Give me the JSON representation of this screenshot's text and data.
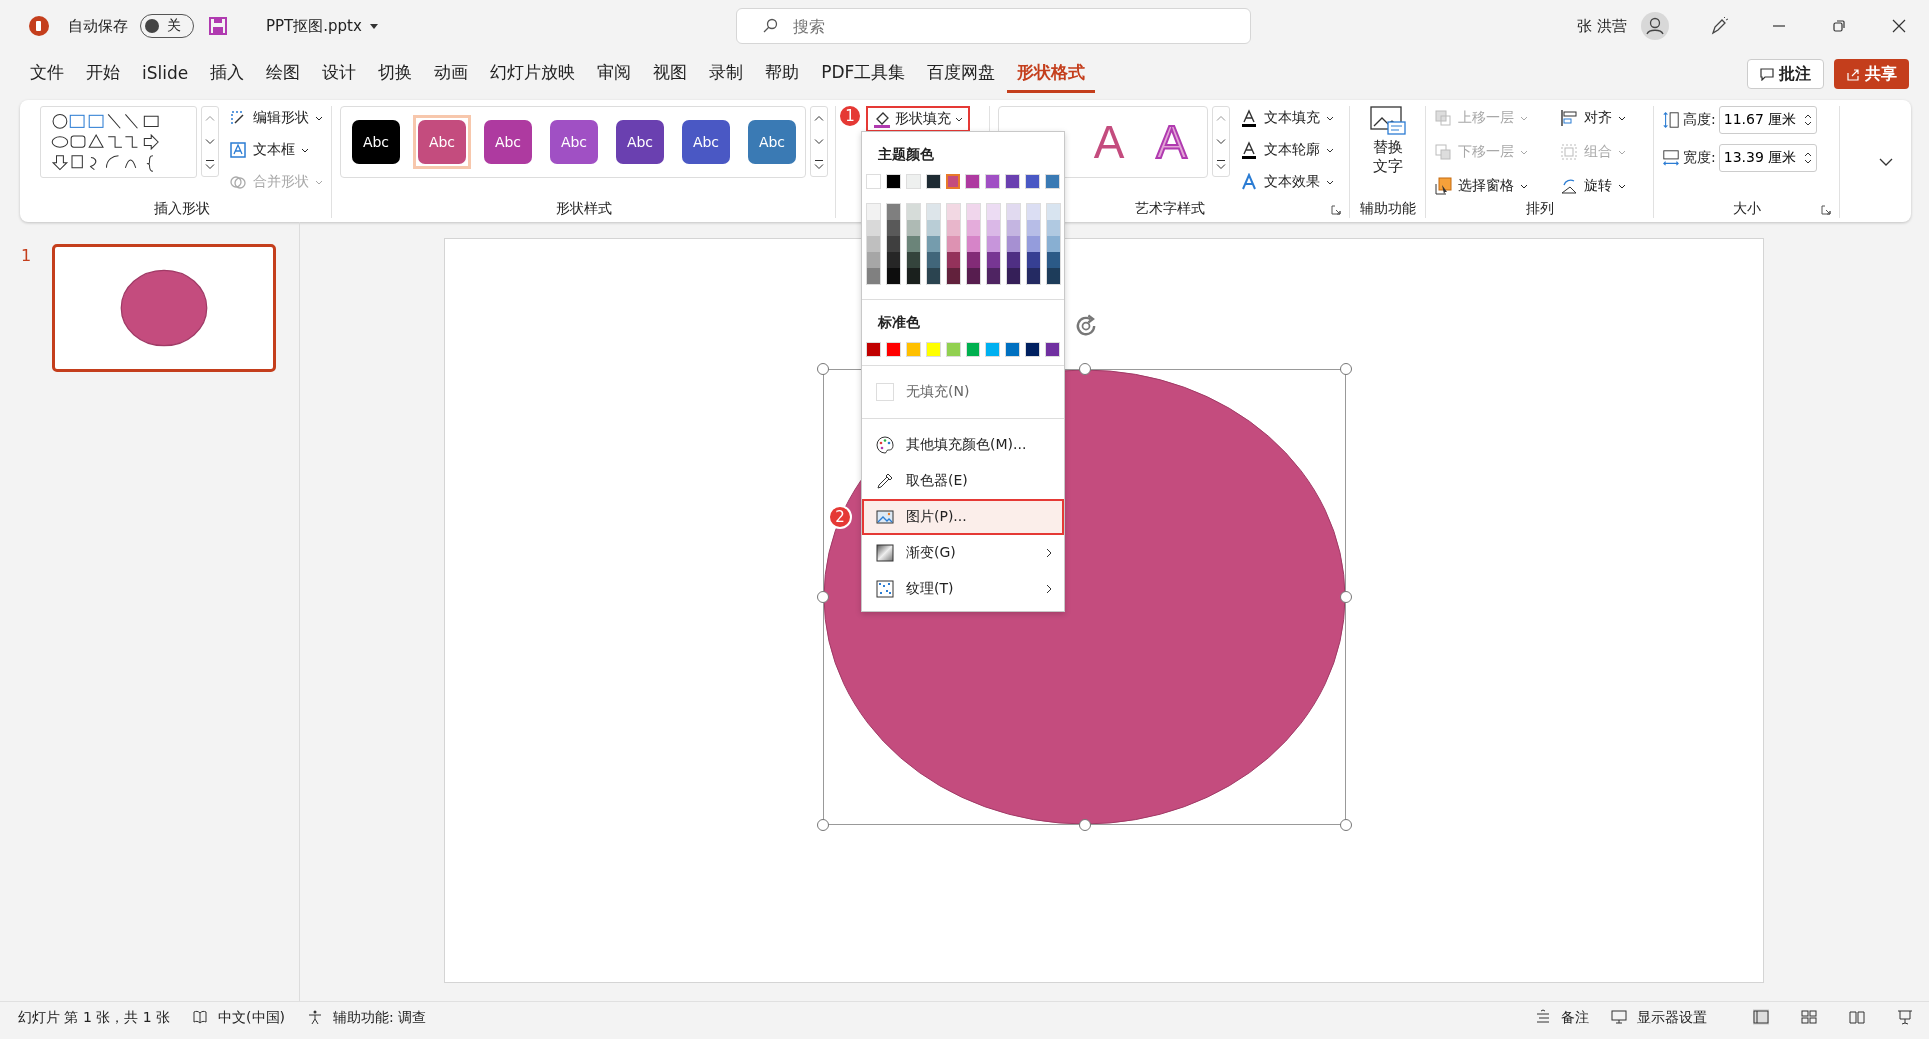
{
  "title_bar": {
    "autosave_label": "自动保存",
    "autosave": {
      "on": false,
      "label": "关"
    },
    "file_name": "PPT抠图.pptx",
    "search_placeholder": "搜索",
    "user_name": "张 洪营"
  },
  "menu_tabs": [
    {
      "label": "文件",
      "selected": false
    },
    {
      "label": "开始",
      "selected": false
    },
    {
      "label": "iSlide",
      "selected": false
    },
    {
      "label": "插入",
      "selected": false
    },
    {
      "label": "绘图",
      "selected": false
    },
    {
      "label": "设计",
      "selected": false
    },
    {
      "label": "切换",
      "selected": false
    },
    {
      "label": "动画",
      "selected": false
    },
    {
      "label": "幻灯片放映",
      "selected": false
    },
    {
      "label": "审阅",
      "selected": false
    },
    {
      "label": "视图",
      "selected": false
    },
    {
      "label": "录制",
      "selected": false
    },
    {
      "label": "帮助",
      "selected": false
    },
    {
      "label": "PDF工具集",
      "selected": false
    },
    {
      "label": "百度网盘",
      "selected": false
    },
    {
      "label": "形状格式",
      "selected": true
    }
  ],
  "comment_button": "批注",
  "share_button": "共享",
  "insert_shapes": {
    "commands": [
      {
        "label": "编辑形状",
        "disabled": false
      },
      {
        "label": "文本框",
        "disabled": false
      },
      {
        "label": "合并形状",
        "disabled": true
      }
    ],
    "group_label": "插入形状"
  },
  "shape_styles": {
    "styles": [
      {
        "label": "Abc",
        "color": "#000000",
        "selected": false
      },
      {
        "label": "Abc",
        "color": "#c44c7e",
        "selected": true
      },
      {
        "label": "Abc",
        "color": "#ae3aa0",
        "selected": false
      },
      {
        "label": "Abc",
        "color": "#a050c4",
        "selected": false
      },
      {
        "label": "Abc",
        "color": "#6a40b0",
        "selected": false
      },
      {
        "label": "Abc",
        "color": "#4a58c4",
        "selected": false
      },
      {
        "label": "Abc",
        "color": "#3a7ab4",
        "selected": false
      }
    ],
    "group_label": "形状样式"
  },
  "fill_button": {
    "label": "形状填充",
    "highlighted": true,
    "step": "1"
  },
  "wordart": {
    "samples": [
      {
        "label": "A",
        "kind": "filled"
      },
      {
        "label": "A",
        "kind": "outline"
      }
    ],
    "commands": [
      {
        "label": "文本填充",
        "kind": "fill"
      },
      {
        "label": "文本轮廓",
        "kind": "outline"
      },
      {
        "label": "文本效果",
        "kind": "effect"
      }
    ],
    "group_label": "艺术字样式"
  },
  "accessibility": {
    "button": "替换文字",
    "group_label": "辅助功能"
  },
  "arrange": {
    "commands": [
      {
        "label": "上移一层",
        "kind": "forward",
        "disabled": true
      },
      {
        "label": "对齐",
        "kind": "align",
        "disabled": false
      },
      {
        "label": "下移一层",
        "kind": "backward",
        "disabled": true
      },
      {
        "label": "组合",
        "kind": "group",
        "disabled": true
      },
      {
        "label": "选择窗格",
        "kind": "pane",
        "disabled": false
      },
      {
        "label": "旋转",
        "kind": "rotate",
        "disabled": false
      }
    ],
    "group_label": "排列"
  },
  "size": {
    "fields": [
      {
        "label": "高度:",
        "value": "11.67 厘米",
        "kind": "height"
      },
      {
        "label": "宽度:",
        "value": "13.39 厘米",
        "kind": "width"
      }
    ],
    "group_label": "大小"
  },
  "fill_menu": {
    "theme_heading": "主题颜色",
    "theme_colors": [
      {
        "color": "#ffffff",
        "selected": false
      },
      {
        "color": "#000000",
        "selected": false
      },
      {
        "color": "#eef0ef",
        "selected": false
      },
      {
        "color": "#1e2b33",
        "selected": false
      },
      {
        "color": "#c44c7e",
        "selected": true
      },
      {
        "color": "#ae3aa0",
        "selected": false
      },
      {
        "color": "#a050c4",
        "selected": false
      },
      {
        "color": "#6a40b0",
        "selected": false
      },
      {
        "color": "#4a58c4",
        "selected": false
      },
      {
        "color": "#3a7ab4",
        "selected": false
      }
    ],
    "shade_columns": [
      {
        "shades": [
          {
            "color": "#f2f2f2"
          },
          {
            "color": "#d9d9d9"
          },
          {
            "color": "#bfbfbf"
          },
          {
            "color": "#a6a6a6"
          },
          {
            "color": "#808080"
          }
        ]
      },
      {
        "shades": [
          {
            "color": "#7f7f7f"
          },
          {
            "color": "#595959"
          },
          {
            "color": "#3f3f3f"
          },
          {
            "color": "#262626"
          },
          {
            "color": "#0d0d0d"
          }
        ]
      },
      {
        "shades": [
          {
            "color": "#d6dcd9"
          },
          {
            "color": "#aebab4"
          },
          {
            "color": "#6b8479"
          },
          {
            "color": "#34443c"
          },
          {
            "color": "#1a201d"
          }
        ]
      },
      {
        "shades": [
          {
            "color": "#dde5ea"
          },
          {
            "color": "#b9cdd6"
          },
          {
            "color": "#759cad"
          },
          {
            "color": "#41667a"
          },
          {
            "color": "#2b4450"
          }
        ]
      },
      {
        "shades": [
          {
            "color": "#f2d8e3"
          },
          {
            "color": "#e8b6cb"
          },
          {
            "color": "#dd92b2"
          },
          {
            "color": "#94325b"
          },
          {
            "color": "#62213c"
          }
        ]
      },
      {
        "shades": [
          {
            "color": "#f0d6ec"
          },
          {
            "color": "#e4acdb"
          },
          {
            "color": "#d684c8"
          },
          {
            "color": "#832b77"
          },
          {
            "color": "#571d4f"
          }
        ]
      },
      {
        "shades": [
          {
            "color": "#ecdcf3"
          },
          {
            "color": "#dab8e7"
          },
          {
            "color": "#c795db"
          },
          {
            "color": "#773693"
          },
          {
            "color": "#4f2462"
          }
        ]
      },
      {
        "shades": [
          {
            "color": "#e1daf0"
          },
          {
            "color": "#c4b5e1"
          },
          {
            "color": "#a690d2"
          },
          {
            "color": "#4f2f84"
          },
          {
            "color": "#351f58"
          }
        ]
      },
      {
        "shades": [
          {
            "color": "#dbdef3"
          },
          {
            "color": "#b7bde7"
          },
          {
            "color": "#949cdc"
          },
          {
            "color": "#363f93"
          },
          {
            "color": "#242a62"
          }
        ]
      },
      {
        "shades": [
          {
            "color": "#d8e4f0"
          },
          {
            "color": "#b0c9e1"
          },
          {
            "color": "#88afd2"
          },
          {
            "color": "#2b5a87"
          },
          {
            "color": "#1d3c5a"
          }
        ]
      }
    ],
    "standard_heading": "标准色",
    "standard_colors": [
      {
        "color": "#c00000"
      },
      {
        "color": "#ff0000"
      },
      {
        "color": "#ffc000"
      },
      {
        "color": "#ffff00"
      },
      {
        "color": "#92d050"
      },
      {
        "color": "#00b050"
      },
      {
        "color": "#00b0f0"
      },
      {
        "color": "#0070c0"
      },
      {
        "color": "#002060"
      },
      {
        "color": "#7030a0"
      }
    ],
    "items": [
      {
        "kind": "no-fill",
        "label": "无填充(N)",
        "highlighted": false,
        "submenu": false
      },
      {
        "kind": "more-colors",
        "label": "其他填充颜色(M)...",
        "highlighted": false,
        "submenu": false
      },
      {
        "kind": "eyedropper",
        "label": "取色器(E)",
        "highlighted": false,
        "submenu": false
      },
      {
        "kind": "picture",
        "label": "图片(P)...",
        "highlighted": true,
        "submenu": false,
        "step": "2"
      },
      {
        "kind": "gradient",
        "label": "渐变(G)",
        "highlighted": false,
        "submenu": true
      },
      {
        "kind": "texture",
        "label": "纹理(T)",
        "highlighted": false,
        "submenu": true
      }
    ]
  },
  "thumbnails": [
    {
      "number": "1",
      "selected": true
    }
  ],
  "status_bar": {
    "slide_info": "幻灯片 第 1 张，共 1 张",
    "language": "中文(中国)",
    "accessibility": "辅助功能: 调查",
    "notes": "备注",
    "display_settings": "显示器设置"
  }
}
